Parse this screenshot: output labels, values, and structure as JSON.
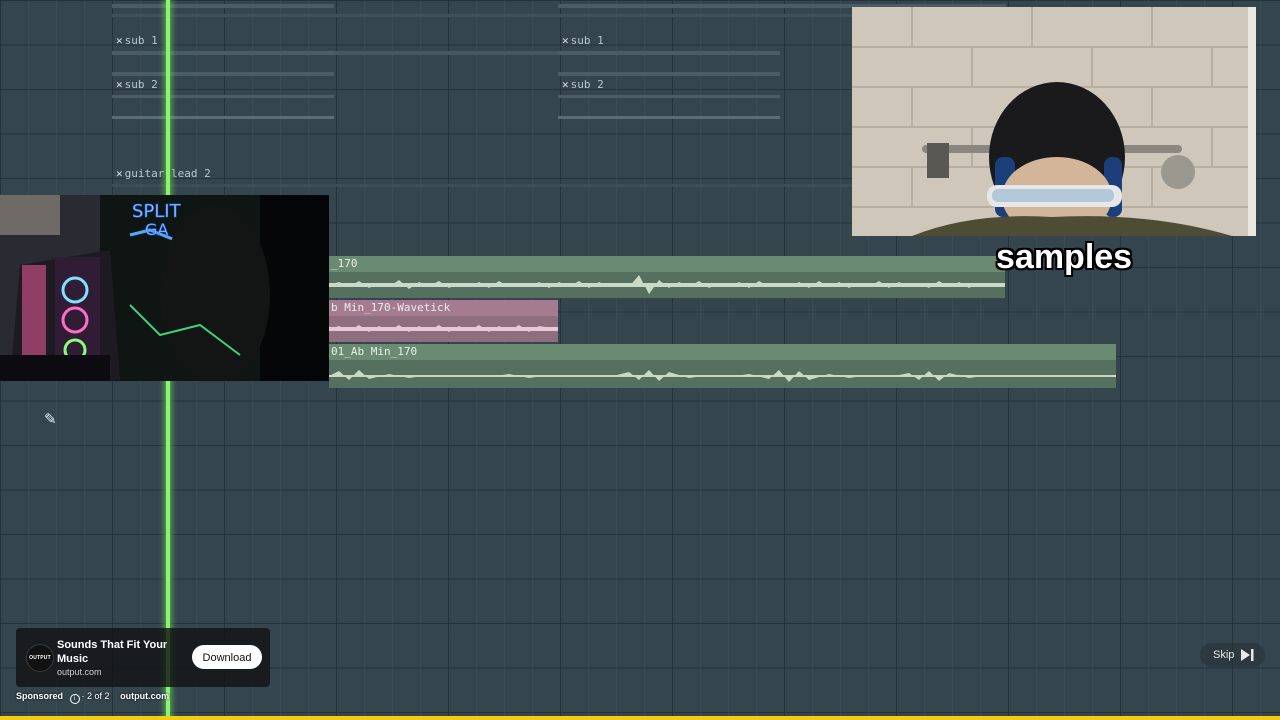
{
  "playlist": {
    "pattern_clips": [
      {
        "label": "sub 1"
      },
      {
        "label": "sub 1"
      },
      {
        "label": "sub 2"
      },
      {
        "label": "sub 2"
      },
      {
        "label": "guitar lead 2"
      }
    ],
    "audio_clips": [
      {
        "label": "_170",
        "color": "#6e8f76"
      },
      {
        "label": "b Min_170-Wavetick",
        "color": "#a87d92"
      },
      {
        "label": "01_Ab Min_170",
        "color": "#6e8f76"
      }
    ],
    "playhead_color": "#8cf56e"
  },
  "caption": {
    "text": "samples"
  },
  "ad": {
    "logo_text": "OUTPUT",
    "title": "Sounds That Fit Your Music",
    "domain": "output.com",
    "cta": "Download",
    "sponsored": "Sponsored",
    "position": "2 of 2",
    "meta_domain": "output.com",
    "skip": "Skip"
  },
  "video": {
    "progress": 1.0,
    "progress_color": "#f2cc14"
  }
}
